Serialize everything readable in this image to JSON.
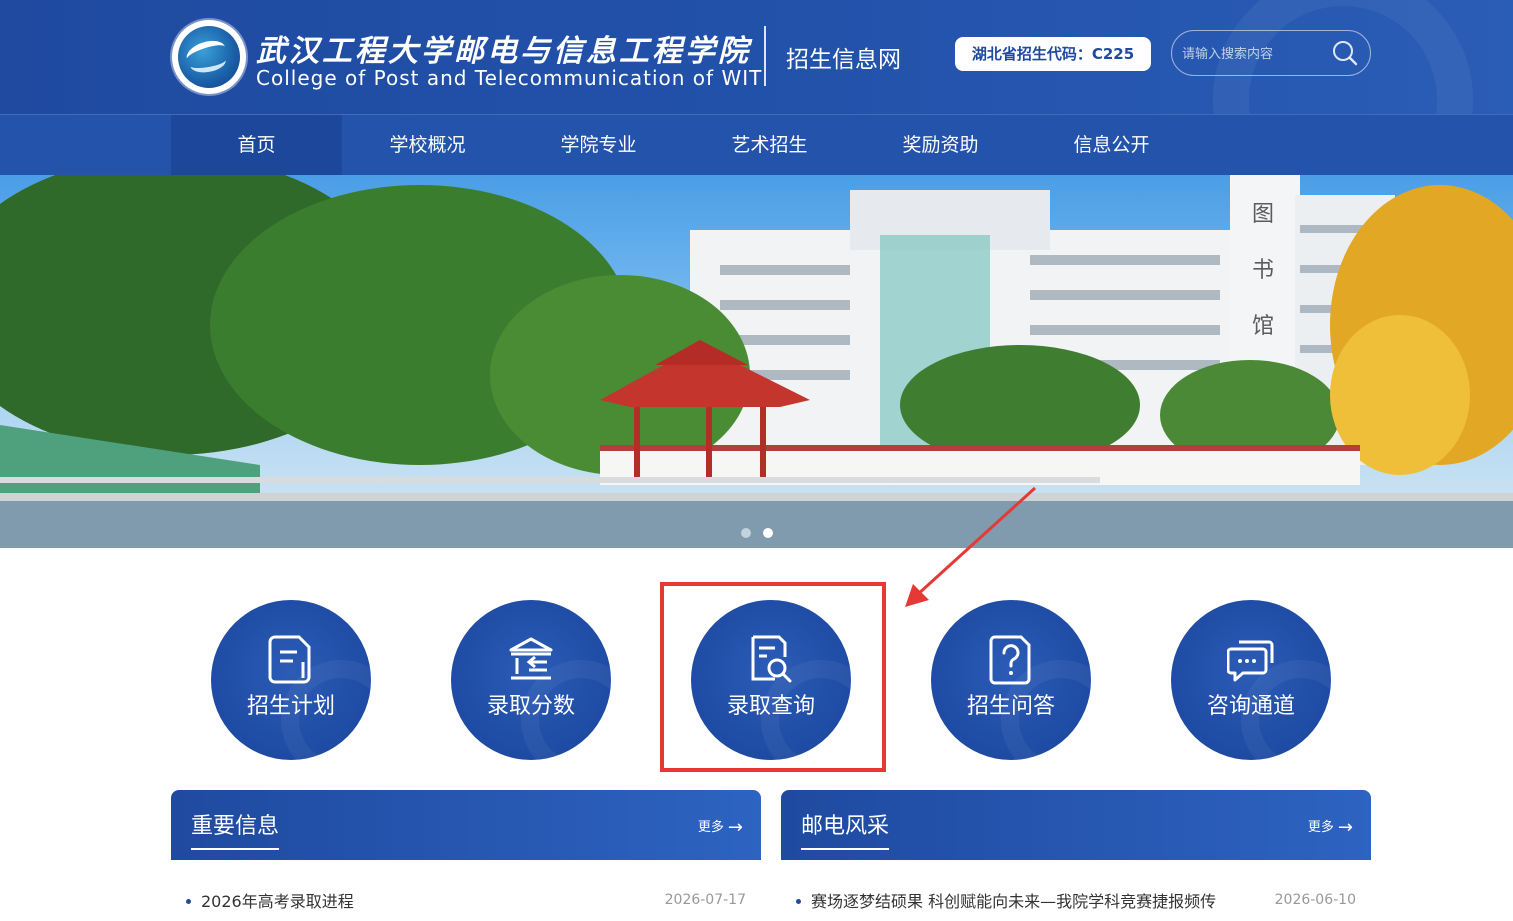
{
  "header": {
    "school_name_cn": "武汉工程大学邮电与信息工程学院",
    "school_name_en": "College of Post and Telecommunication of WIT",
    "site_name": "招生信息网",
    "code_badge": "湖北省招生代码：C225",
    "search_placeholder": "请输入搜索内容",
    "colors": {
      "primary": "#1f4aa0",
      "nav": "#2353ab",
      "highlight": "#e53935"
    }
  },
  "nav": {
    "items": [
      {
        "label": "首页",
        "active": true
      },
      {
        "label": "学校概况"
      },
      {
        "label": "学院专业"
      },
      {
        "label": "艺术招生"
      },
      {
        "label": "奖励资助"
      },
      {
        "label": "信息公开"
      }
    ]
  },
  "banner": {
    "building_sign": "图书馆",
    "slide_count": 2,
    "current_slide": 2
  },
  "quick_links": [
    {
      "label": "招生计划",
      "icon": "document-icon"
    },
    {
      "label": "录取分数",
      "icon": "institution-icon"
    },
    {
      "label": "录取查询",
      "icon": "search-document-icon",
      "highlighted": true
    },
    {
      "label": "招生问答",
      "icon": "question-icon"
    },
    {
      "label": "咨询通道",
      "icon": "chat-icon"
    }
  ],
  "panels": {
    "important": {
      "title": "重要信息",
      "more": "更多",
      "items": [
        {
          "text": "2026年高考录取进程",
          "date": "2026-07-17"
        }
      ]
    },
    "style": {
      "title": "邮电风采",
      "more": "更多",
      "items": [
        {
          "text": "赛场逐梦结硕果 科创赋能向未来—我院学科竞赛捷报频传",
          "date": "2026-06-10"
        }
      ]
    }
  }
}
